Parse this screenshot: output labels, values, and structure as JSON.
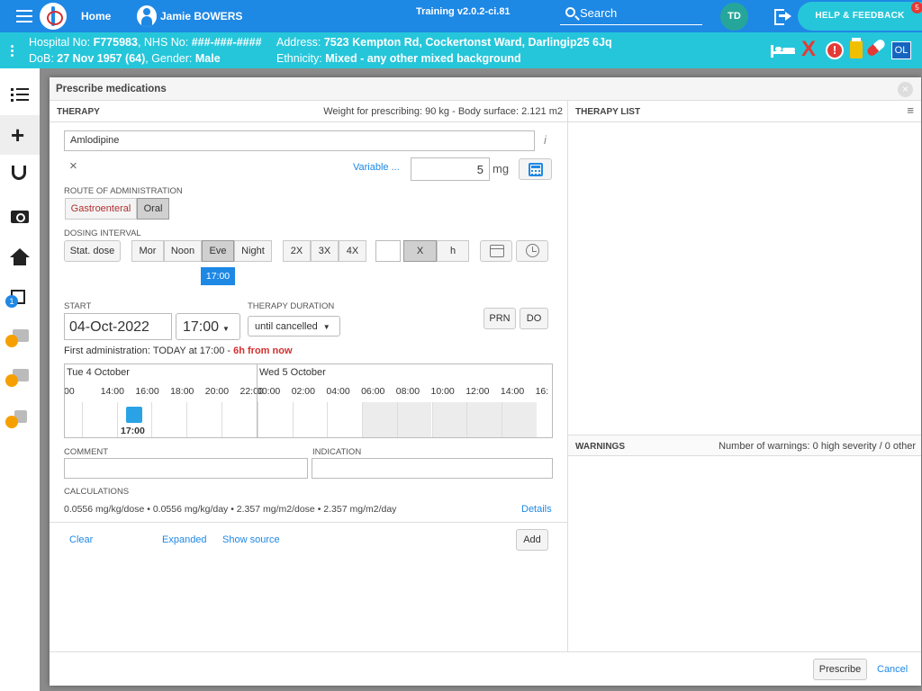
{
  "topbar": {
    "home_label": "Home",
    "patient_name": "Jamie BOWERS",
    "environment": "Training v2.0.2-ci.81",
    "search_label": "Search",
    "user_initials": "TD",
    "help_label": "HELP & FEEDBACK",
    "help_badge": "5"
  },
  "patient_bar": {
    "hospital_no_label": "Hospital No:",
    "hospital_no": "F775983",
    "nhs_no_label": ", NHS No:",
    "nhs_no": "###-###-####",
    "dob_label": "DoB:",
    "dob": "27 Nov 1957 (64)",
    "gender_label": ", Gender:",
    "gender": "Male",
    "address_label": "Address:",
    "address": "7523 Kempton Rd, Cockertonst Ward, Darlingip25 6Jq",
    "ethnicity_label": "Ethnicity:",
    "ethnicity": "Mixed - any other mixed background",
    "alert_x": "X",
    "alert_excl": "!",
    "ol_label": "OL"
  },
  "leftnav": {
    "edit_badge": "1"
  },
  "modal": {
    "title": "Prescribe medications",
    "close": "×",
    "therapy": {
      "section_title": "THERAPY",
      "weight_info": "Weight for prescribing: 90 kg - Body surface: 2.121 m2",
      "medication_value": "Amlodipine",
      "info_glyph": "i",
      "clear_x": "×",
      "variable_link": "Variable ...",
      "dose_value": "5",
      "dose_unit": "mg",
      "route_label": "ROUTE OF ADMINISTRATION",
      "routes": [
        "Gastroenteral",
        "Oral"
      ],
      "route_selected": "Oral",
      "dosing_label": "DOSING INTERVAL",
      "stat_dose": "Stat. dose",
      "times_of_day": [
        "Mor",
        "Noon",
        "Eve",
        "Night"
      ],
      "time_selected": "Eve",
      "time_tooltip": "17:00",
      "frequencies": [
        "2X",
        "3X",
        "4X"
      ],
      "freq_x": "X",
      "freq_h": "h",
      "start_label": "START",
      "start_date": "04-Oct-2022",
      "start_time": "17:00",
      "duration_label": "THERAPY DURATION",
      "duration_value": "until cancelled",
      "prn": "PRN",
      "do": "DO",
      "first_admin_text": "First administration: TODAY at 17:00 -",
      "first_admin_highlight": "6h from now",
      "timeline": {
        "day1": "Tue 4 October",
        "day2": "Wed 5 October",
        "hours": [
          "00",
          "14:00",
          "16:00",
          "18:00",
          "20:00",
          "22:00",
          "00:00",
          "02:00",
          "04:00",
          "06:00",
          "08:00",
          "10:00",
          "12:00",
          "14:00",
          "16:"
        ],
        "dose_time": "17:00"
      },
      "comment_label": "COMMENT",
      "indication_label": "INDICATION",
      "calculations_label": "CALCULATIONS",
      "calculations_text": "0.0556 mg/kg/dose • 0.0556 mg/kg/day • 2.357 mg/m2/dose • 2.357 mg/m2/day",
      "details_link": "Details",
      "clear_link": "Clear",
      "expanded_link": "Expanded",
      "show_source_link": "Show source",
      "add_button": "Add"
    },
    "therapy_list": {
      "section_title": "THERAPY LIST",
      "menu_glyph": "≡"
    },
    "warnings": {
      "section_title": "WARNINGS",
      "summary": "Number of warnings: 0 high severity / 0 other"
    },
    "footer": {
      "prescribe_button": "Prescribe",
      "cancel_link": "Cancel"
    }
  }
}
